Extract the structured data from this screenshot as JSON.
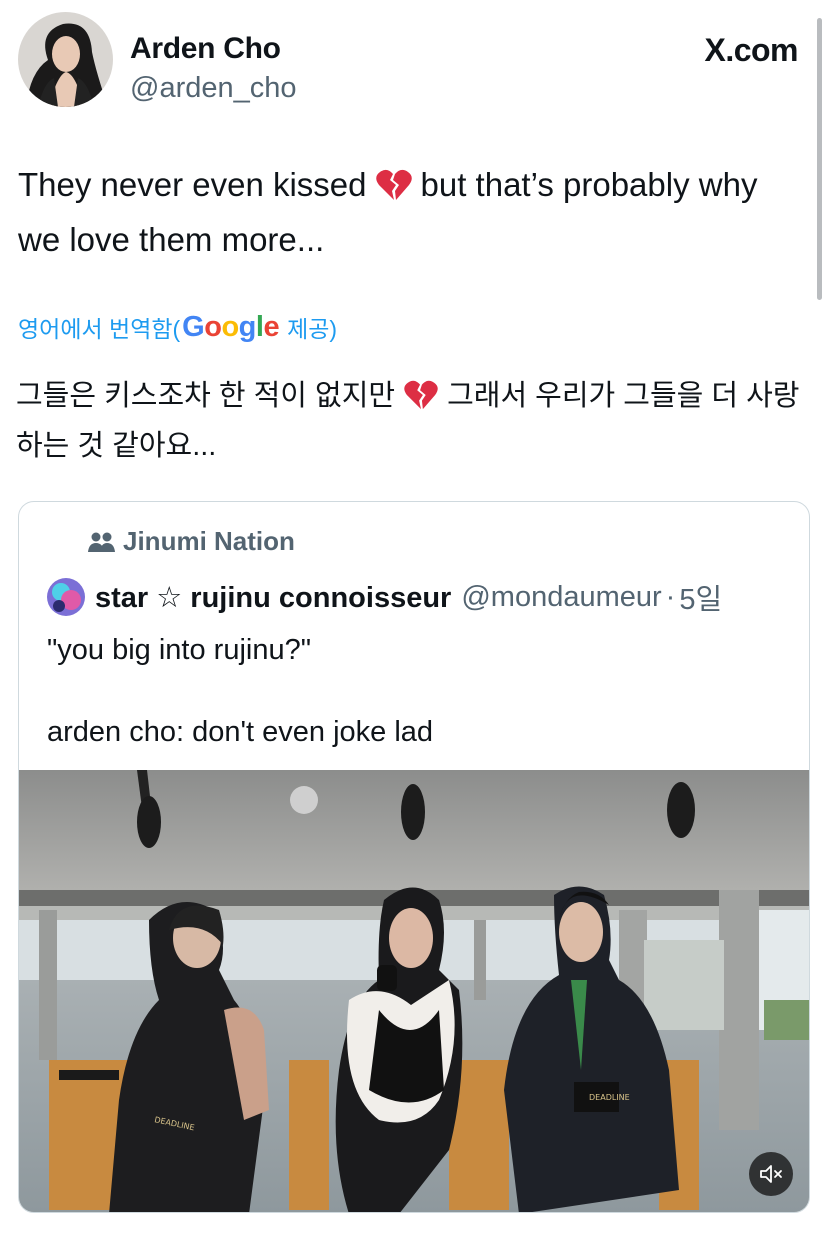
{
  "author": {
    "name": "Arden Cho",
    "handle": "@arden_cho"
  },
  "brand": "X.com",
  "tweet": {
    "text_part1": "They never even kissed",
    "emoji": "broken-heart-icon",
    "text_part2": "but that’s probably why we love them more..."
  },
  "translation": {
    "prefix": "영어에서 번역함(",
    "google": "Google",
    "suffix": "제공)",
    "text_part1": "그들은 키스조차 한 적이 없지만",
    "text_part2": "그래서 우리가 그들을 더 사랑하는 것 같아요..."
  },
  "quote": {
    "community": "Jinumi Nation",
    "author_name": "star ☆ rujinu connoisseur",
    "author_handle": "@mondaumeur",
    "separator": "·",
    "time": "5일",
    "text": "\"you big into rujinu?\"\n\narden cho: don't even joke lad",
    "video_signs": [
      "DEADLINE",
      "DEADLINE"
    ]
  },
  "colors": {
    "accent": "#1d9bf0",
    "secondary_text": "#536471",
    "border": "#cfd9de"
  }
}
